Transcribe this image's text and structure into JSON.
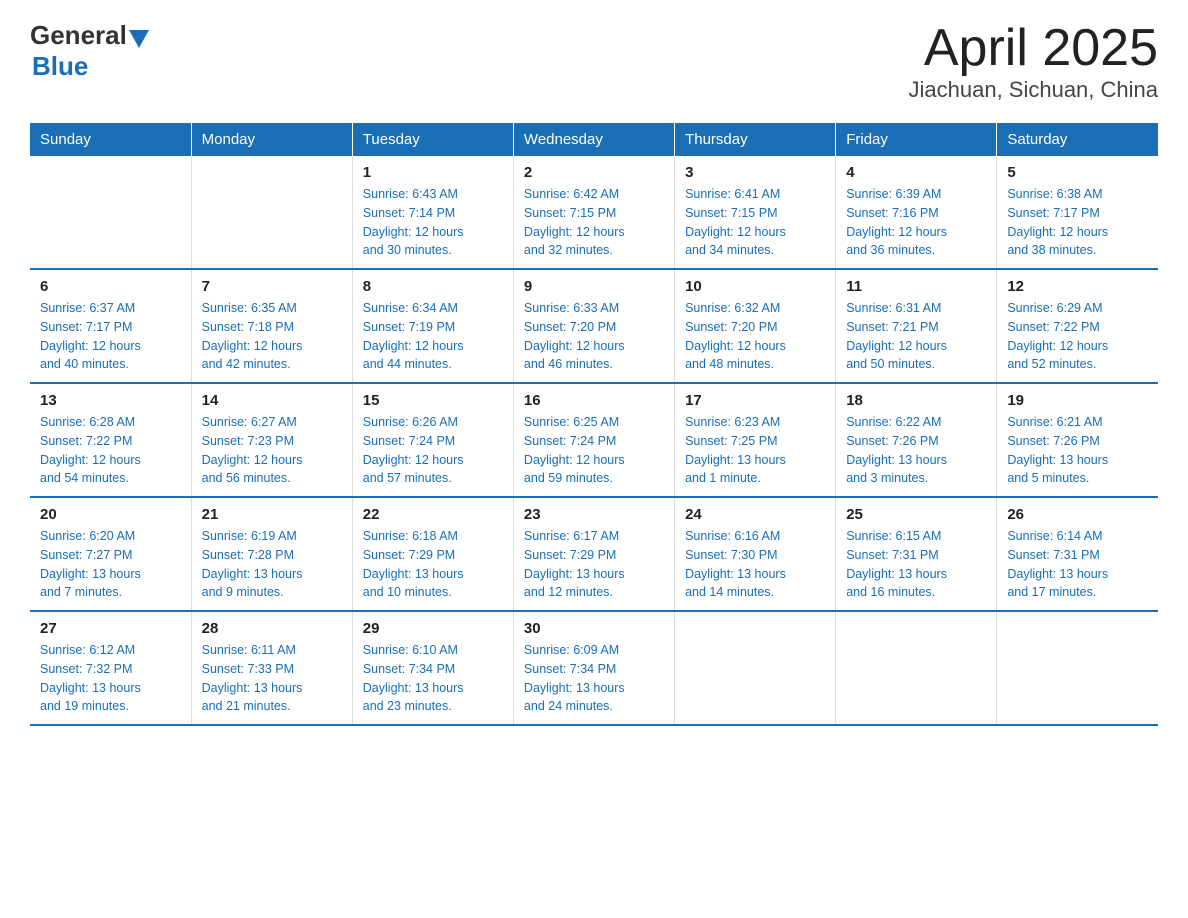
{
  "logo": {
    "general": "General",
    "blue": "Blue"
  },
  "title": "April 2025",
  "subtitle": "Jiachuan, Sichuan, China",
  "days_of_week": [
    "Sunday",
    "Monday",
    "Tuesday",
    "Wednesday",
    "Thursday",
    "Friday",
    "Saturday"
  ],
  "weeks": [
    [
      {
        "day": "",
        "info": ""
      },
      {
        "day": "",
        "info": ""
      },
      {
        "day": "1",
        "info": "Sunrise: 6:43 AM\nSunset: 7:14 PM\nDaylight: 12 hours\nand 30 minutes."
      },
      {
        "day": "2",
        "info": "Sunrise: 6:42 AM\nSunset: 7:15 PM\nDaylight: 12 hours\nand 32 minutes."
      },
      {
        "day": "3",
        "info": "Sunrise: 6:41 AM\nSunset: 7:15 PM\nDaylight: 12 hours\nand 34 minutes."
      },
      {
        "day": "4",
        "info": "Sunrise: 6:39 AM\nSunset: 7:16 PM\nDaylight: 12 hours\nand 36 minutes."
      },
      {
        "day": "5",
        "info": "Sunrise: 6:38 AM\nSunset: 7:17 PM\nDaylight: 12 hours\nand 38 minutes."
      }
    ],
    [
      {
        "day": "6",
        "info": "Sunrise: 6:37 AM\nSunset: 7:17 PM\nDaylight: 12 hours\nand 40 minutes."
      },
      {
        "day": "7",
        "info": "Sunrise: 6:35 AM\nSunset: 7:18 PM\nDaylight: 12 hours\nand 42 minutes."
      },
      {
        "day": "8",
        "info": "Sunrise: 6:34 AM\nSunset: 7:19 PM\nDaylight: 12 hours\nand 44 minutes."
      },
      {
        "day": "9",
        "info": "Sunrise: 6:33 AM\nSunset: 7:20 PM\nDaylight: 12 hours\nand 46 minutes."
      },
      {
        "day": "10",
        "info": "Sunrise: 6:32 AM\nSunset: 7:20 PM\nDaylight: 12 hours\nand 48 minutes."
      },
      {
        "day": "11",
        "info": "Sunrise: 6:31 AM\nSunset: 7:21 PM\nDaylight: 12 hours\nand 50 minutes."
      },
      {
        "day": "12",
        "info": "Sunrise: 6:29 AM\nSunset: 7:22 PM\nDaylight: 12 hours\nand 52 minutes."
      }
    ],
    [
      {
        "day": "13",
        "info": "Sunrise: 6:28 AM\nSunset: 7:22 PM\nDaylight: 12 hours\nand 54 minutes."
      },
      {
        "day": "14",
        "info": "Sunrise: 6:27 AM\nSunset: 7:23 PM\nDaylight: 12 hours\nand 56 minutes."
      },
      {
        "day": "15",
        "info": "Sunrise: 6:26 AM\nSunset: 7:24 PM\nDaylight: 12 hours\nand 57 minutes."
      },
      {
        "day": "16",
        "info": "Sunrise: 6:25 AM\nSunset: 7:24 PM\nDaylight: 12 hours\nand 59 minutes."
      },
      {
        "day": "17",
        "info": "Sunrise: 6:23 AM\nSunset: 7:25 PM\nDaylight: 13 hours\nand 1 minute."
      },
      {
        "day": "18",
        "info": "Sunrise: 6:22 AM\nSunset: 7:26 PM\nDaylight: 13 hours\nand 3 minutes."
      },
      {
        "day": "19",
        "info": "Sunrise: 6:21 AM\nSunset: 7:26 PM\nDaylight: 13 hours\nand 5 minutes."
      }
    ],
    [
      {
        "day": "20",
        "info": "Sunrise: 6:20 AM\nSunset: 7:27 PM\nDaylight: 13 hours\nand 7 minutes."
      },
      {
        "day": "21",
        "info": "Sunrise: 6:19 AM\nSunset: 7:28 PM\nDaylight: 13 hours\nand 9 minutes."
      },
      {
        "day": "22",
        "info": "Sunrise: 6:18 AM\nSunset: 7:29 PM\nDaylight: 13 hours\nand 10 minutes."
      },
      {
        "day": "23",
        "info": "Sunrise: 6:17 AM\nSunset: 7:29 PM\nDaylight: 13 hours\nand 12 minutes."
      },
      {
        "day": "24",
        "info": "Sunrise: 6:16 AM\nSunset: 7:30 PM\nDaylight: 13 hours\nand 14 minutes."
      },
      {
        "day": "25",
        "info": "Sunrise: 6:15 AM\nSunset: 7:31 PM\nDaylight: 13 hours\nand 16 minutes."
      },
      {
        "day": "26",
        "info": "Sunrise: 6:14 AM\nSunset: 7:31 PM\nDaylight: 13 hours\nand 17 minutes."
      }
    ],
    [
      {
        "day": "27",
        "info": "Sunrise: 6:12 AM\nSunset: 7:32 PM\nDaylight: 13 hours\nand 19 minutes."
      },
      {
        "day": "28",
        "info": "Sunrise: 6:11 AM\nSunset: 7:33 PM\nDaylight: 13 hours\nand 21 minutes."
      },
      {
        "day": "29",
        "info": "Sunrise: 6:10 AM\nSunset: 7:34 PM\nDaylight: 13 hours\nand 23 minutes."
      },
      {
        "day": "30",
        "info": "Sunrise: 6:09 AM\nSunset: 7:34 PM\nDaylight: 13 hours\nand 24 minutes."
      },
      {
        "day": "",
        "info": ""
      },
      {
        "day": "",
        "info": ""
      },
      {
        "day": "",
        "info": ""
      }
    ]
  ]
}
